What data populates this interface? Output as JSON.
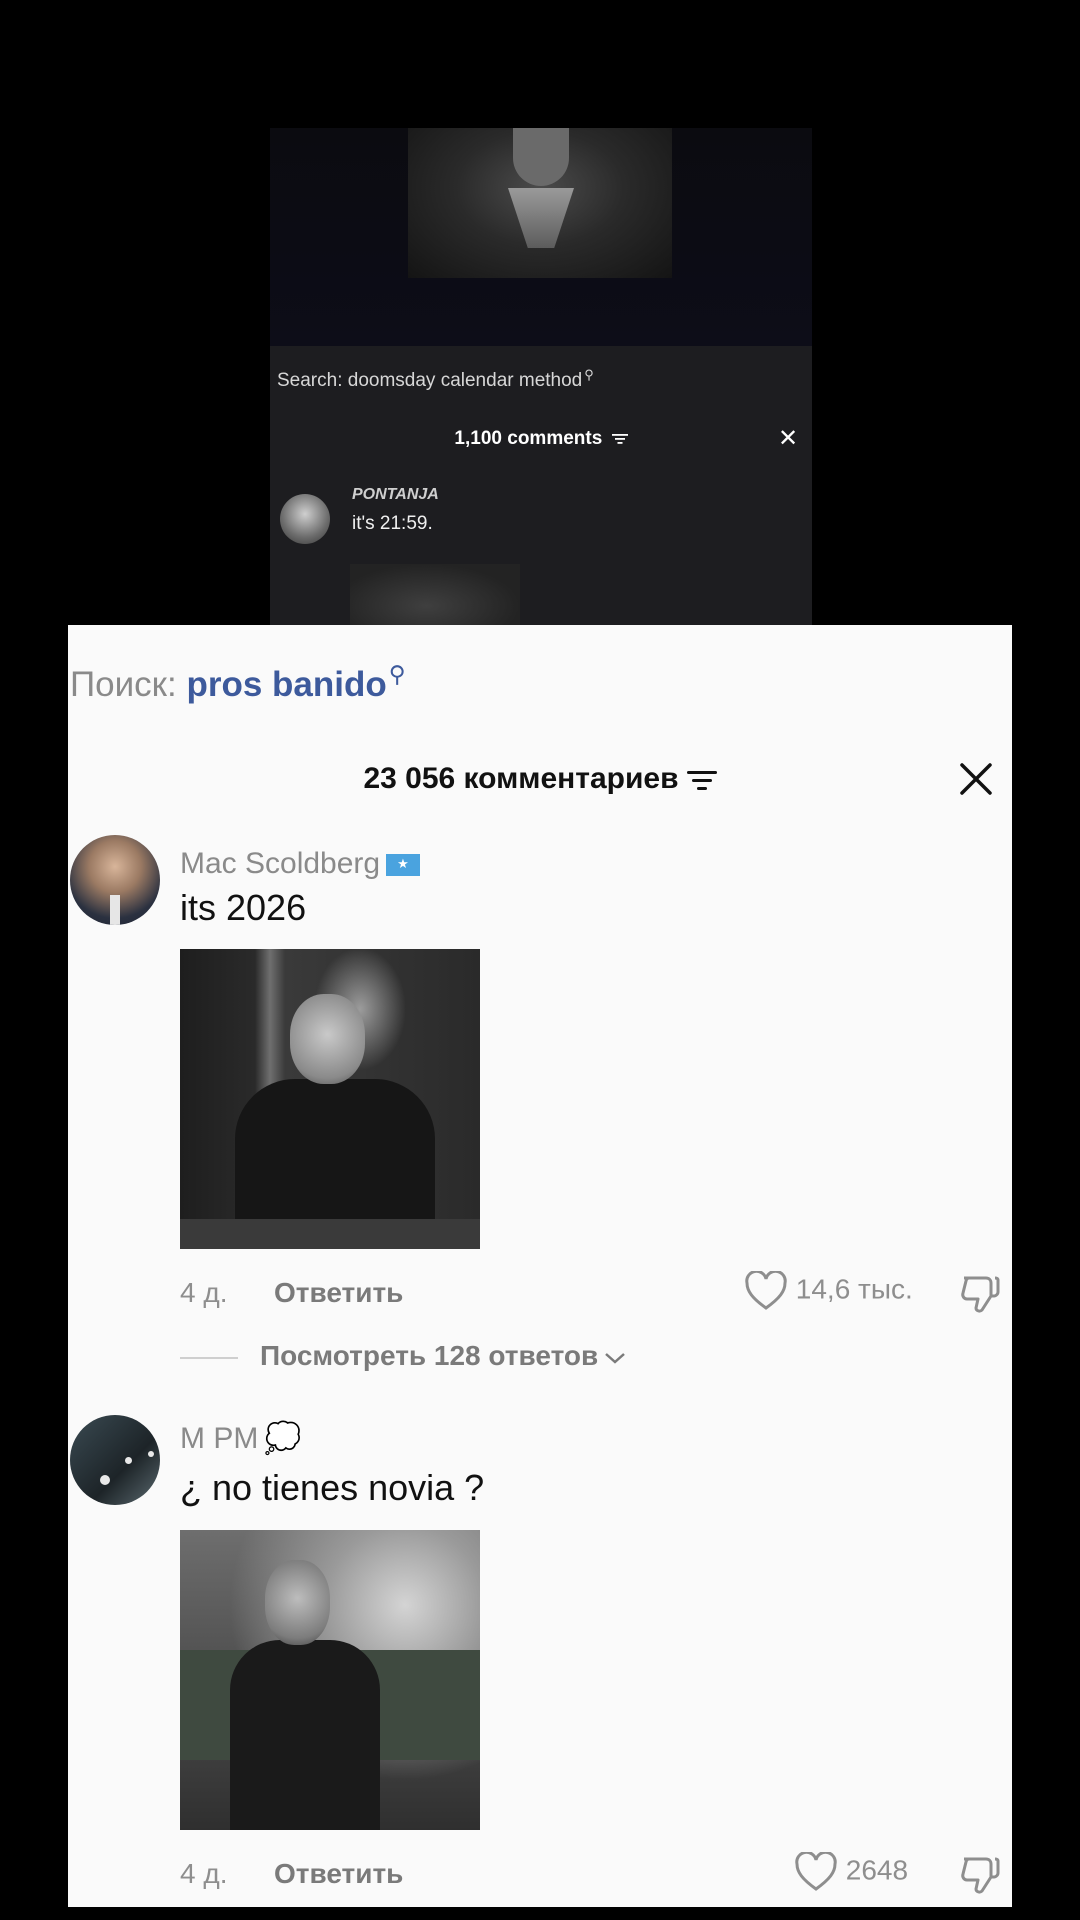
{
  "top_screenshot": {
    "search_label": "Search: doomsday calendar method",
    "comment_count": "1,100 comments",
    "comment": {
      "username": "PONTANJA",
      "text": "it's 21:59."
    }
  },
  "panel": {
    "search": {
      "label": "Поиск:",
      "term": "pros banido"
    },
    "comment_count": "23 056 комментариев",
    "comments": [
      {
        "username": "Mac Scoldberg",
        "text": "its 2026",
        "time": "4 д.",
        "reply_label": "Ответить",
        "likes": "14,6 тыс.",
        "view_replies": "Посмотреть 128 ответов"
      },
      {
        "username": "M PM",
        "text": "¿ no tienes novia ?",
        "time": "4 д.",
        "reply_label": "Ответить",
        "likes": "2648"
      }
    ]
  },
  "colors": {
    "panel_bg": "#fafafa",
    "accent_search": "#3d5a9c",
    "page_bg": "#000000"
  },
  "icons": [
    "search-icon",
    "filter-icon",
    "close-icon",
    "flag-icon",
    "thought-bubble-icon",
    "heart-icon",
    "dislike-icon",
    "chevron-down-icon"
  ]
}
